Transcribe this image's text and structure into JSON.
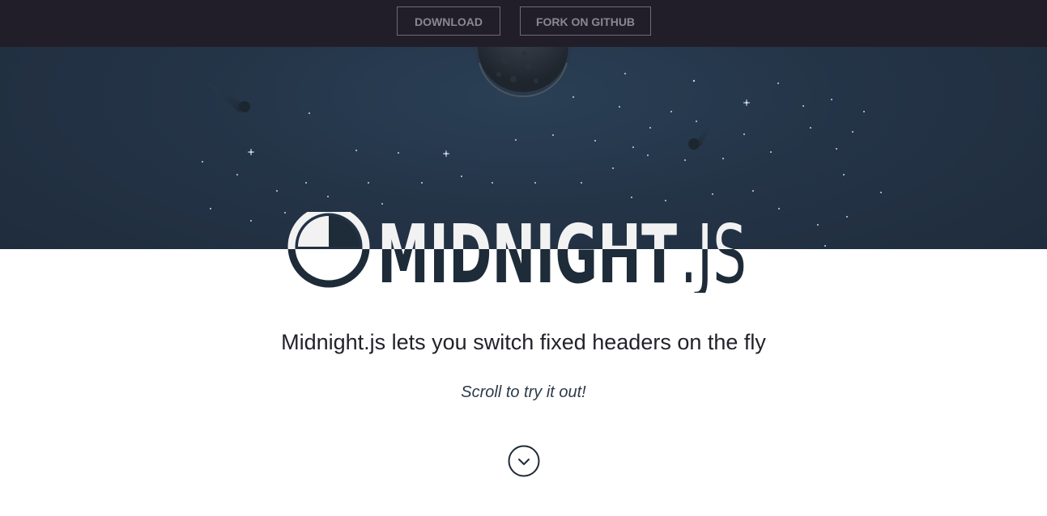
{
  "header": {
    "download_label": "DOWNLOAD",
    "fork_label": "FORK ON GITHUB"
  },
  "logo": {
    "name": "MIDNIGHT",
    "suffix": ".JS",
    "icon": "half-moon-icon"
  },
  "content": {
    "tagline": "Midnight.js lets you switch fixed headers on the fly",
    "scroll_hint": "Scroll to try it out!",
    "scroll_icon": "chevron-down-icon"
  },
  "colors": {
    "header_bg": "#211e29",
    "hero_bg": "#243447",
    "logo_dark": "#1e2b38",
    "logo_light": "#f2f2f2"
  }
}
